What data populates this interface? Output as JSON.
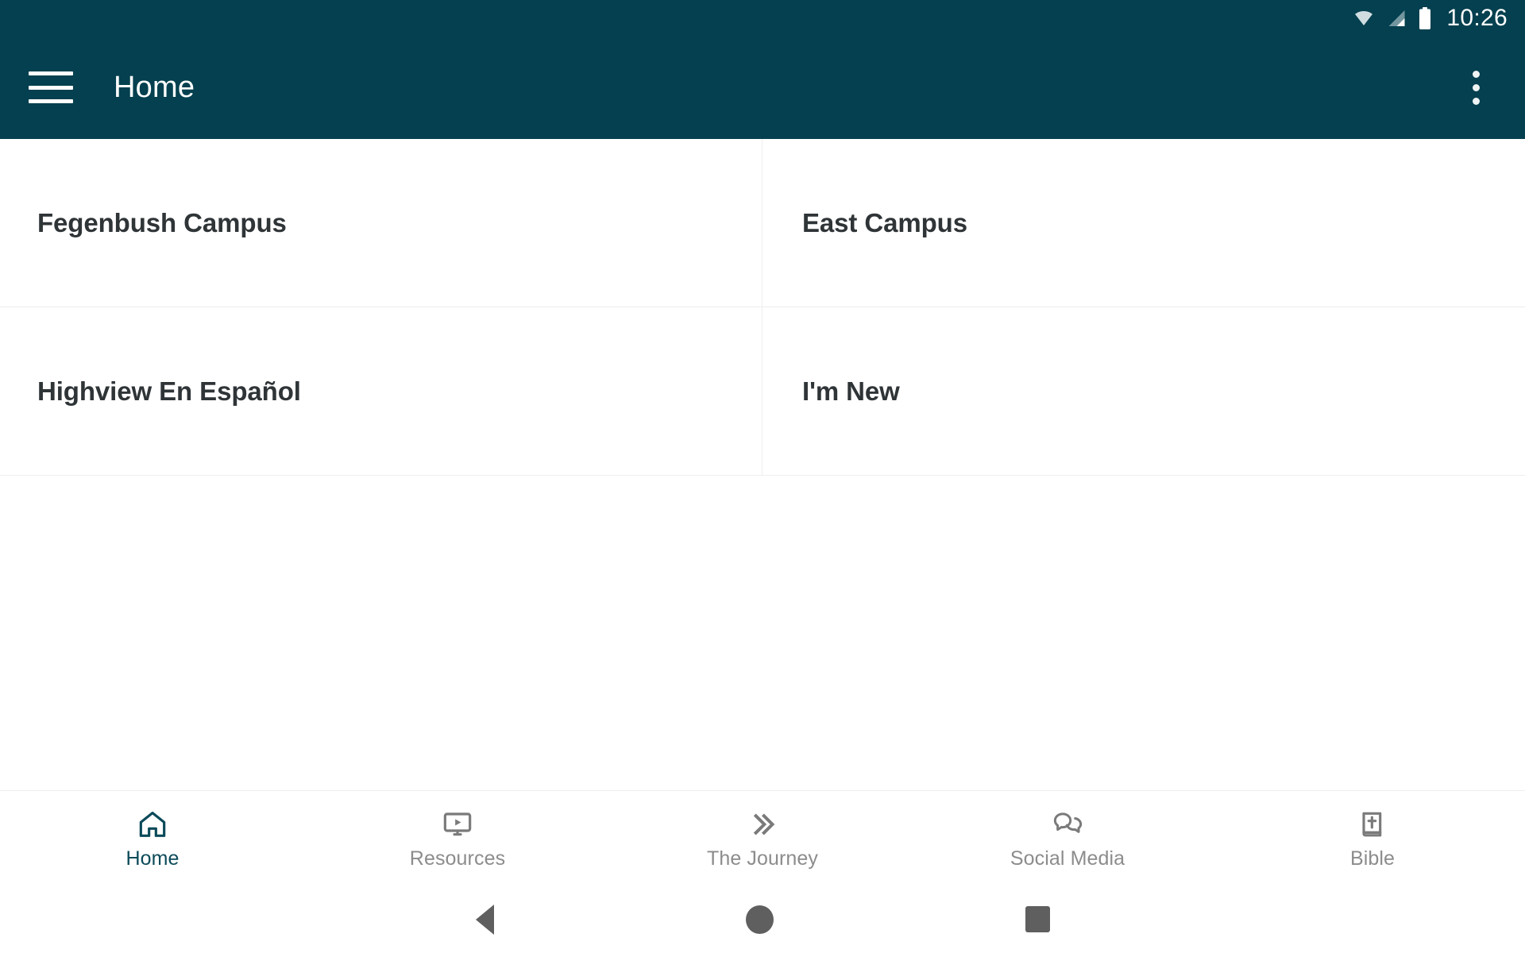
{
  "status_bar": {
    "time": "10:26",
    "icons": [
      "wifi-icon",
      "cellular-signal-icon",
      "battery-icon"
    ]
  },
  "app_bar": {
    "menu_icon": "hamburger-menu-icon",
    "title": "Home",
    "overflow_icon": "overflow-menu-icon",
    "background_color": "#04404f"
  },
  "home_grid": {
    "cards": [
      {
        "label": "Fegenbush Campus"
      },
      {
        "label": "East Campus"
      },
      {
        "label": "Highview En Español"
      },
      {
        "label": "I'm New"
      }
    ]
  },
  "bottom_nav": {
    "active_color": "#0b4a59",
    "inactive_color": "#8c8c8c",
    "tabs": [
      {
        "label": "Home",
        "icon": "home-icon",
        "active": true
      },
      {
        "label": "Resources",
        "icon": "monitor-play-icon",
        "active": false
      },
      {
        "label": "The Journey",
        "icon": "double-chevron-right-icon",
        "active": false
      },
      {
        "label": "Social Media",
        "icon": "chat-bubbles-icon",
        "active": false
      },
      {
        "label": "Bible",
        "icon": "book-cross-icon",
        "active": false
      }
    ]
  },
  "system_nav": {
    "buttons": [
      {
        "name": "back-button",
        "icon": "triangle-back-icon"
      },
      {
        "name": "home-button",
        "icon": "circle-home-icon"
      },
      {
        "name": "recents-button",
        "icon": "square-recents-icon"
      }
    ]
  }
}
